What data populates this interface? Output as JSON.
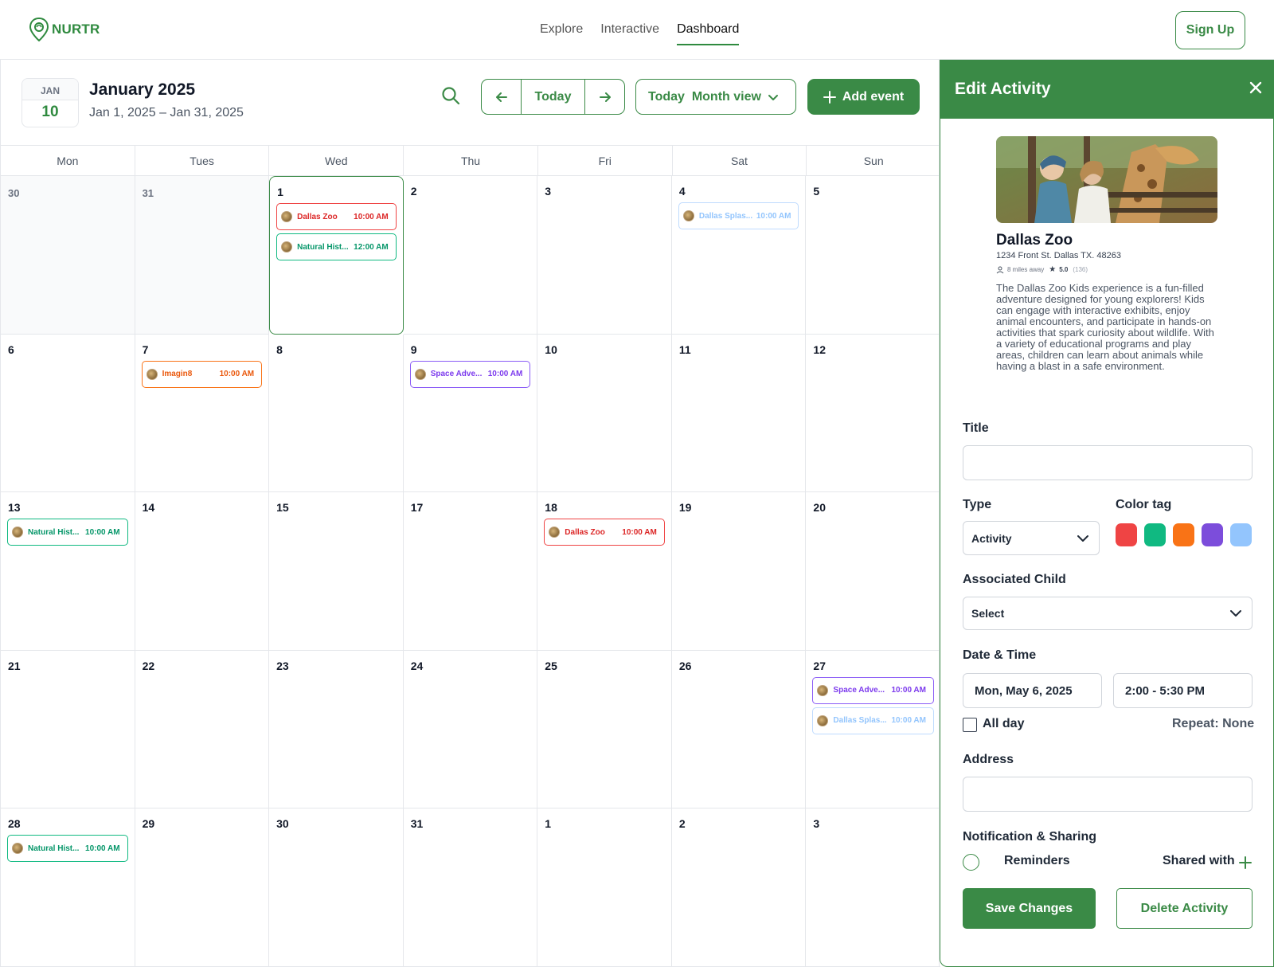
{
  "nav": {
    "brand": "NURTR",
    "links": [
      "Explore",
      "Interactive",
      "Dashboard"
    ],
    "active": "Dashboard",
    "signup_label": "Sign Up"
  },
  "calendar": {
    "date_badge": {
      "month": "JAN",
      "day": "10"
    },
    "title": "January 2025",
    "range": "Jan 1, 2025 – Jan 31, 2025",
    "today_label": "Today",
    "view_label": "Today  Month view",
    "add_event_label": "Add event",
    "weekdays": [
      "Mon",
      "Tues",
      "Wed",
      "Thu",
      "Fri",
      "Sat",
      "Sun"
    ],
    "cells": [
      {
        "day": "30",
        "muted": true,
        "events": []
      },
      {
        "day": "31",
        "muted": true,
        "events": []
      },
      {
        "day": "1",
        "selected": true,
        "events": [
          {
            "name": "Dallas Zoo",
            "time": "10:00 AM",
            "color": "red"
          },
          {
            "name": "Natural Hist...",
            "time": "12:00 AM",
            "color": "green"
          }
        ]
      },
      {
        "day": "2",
        "events": []
      },
      {
        "day": "3",
        "events": []
      },
      {
        "day": "4",
        "events": [
          {
            "name": "Dallas Splas...",
            "time": "10:00 AM",
            "color": "blue"
          }
        ]
      },
      {
        "day": "5",
        "events": []
      },
      {
        "day": "6",
        "events": []
      },
      {
        "day": "7",
        "events": [
          {
            "name": "Imagin8",
            "time": "10:00 AM",
            "color": "orange"
          }
        ]
      },
      {
        "day": "8",
        "events": []
      },
      {
        "day": "9",
        "events": [
          {
            "name": "Space Adve...",
            "time": "10:00 AM",
            "color": "purple"
          }
        ]
      },
      {
        "day": "10",
        "events": []
      },
      {
        "day": "11",
        "events": []
      },
      {
        "day": "12",
        "events": []
      },
      {
        "day": "13",
        "events": [
          {
            "name": "Natural Hist...",
            "time": "10:00 AM",
            "color": "green"
          }
        ]
      },
      {
        "day": "14",
        "events": []
      },
      {
        "day": "15",
        "events": []
      },
      {
        "day": "17",
        "events": []
      },
      {
        "day": "18",
        "events": [
          {
            "name": "Dallas Zoo",
            "time": "10:00 AM",
            "color": "red"
          }
        ]
      },
      {
        "day": "19",
        "events": []
      },
      {
        "day": "20",
        "events": []
      },
      {
        "day": "21",
        "events": []
      },
      {
        "day": "22",
        "events": []
      },
      {
        "day": "23",
        "events": []
      },
      {
        "day": "24",
        "events": []
      },
      {
        "day": "25",
        "events": []
      },
      {
        "day": "26",
        "events": []
      },
      {
        "day": "27",
        "events": [
          {
            "name": "Space Adve...",
            "time": "10:00 AM",
            "color": "purple"
          },
          {
            "name": "Dallas Splas...",
            "time": "10:00 AM",
            "color": "blue"
          }
        ]
      },
      {
        "day": "28",
        "events": [
          {
            "name": "Natural Hist...",
            "time": "10:00 AM",
            "color": "green"
          }
        ]
      },
      {
        "day": "29",
        "events": []
      },
      {
        "day": "30",
        "events": []
      },
      {
        "day": "31",
        "events": []
      },
      {
        "day": "1",
        "events": []
      },
      {
        "day": "2",
        "events": []
      },
      {
        "day": "3",
        "events": []
      }
    ]
  },
  "panel": {
    "title": "Edit Activity",
    "activity": {
      "name": "Dallas Zoo",
      "address": "1234 Front St. Dallas TX. 48263",
      "distance": "8 miles away",
      "rating": "5.0",
      "reviews": "(136)",
      "description": "The Dallas Zoo Kids experience is a fun-filled adventure designed for young explorers! Kids can engage with interactive exhibits, enjoy animal encounters, and participate in hands-on activities that spark curiosity about wildlife. With a variety of educational programs and play areas, children can learn about animals while having a blast in a safe environment."
    },
    "labels": {
      "title": "Title",
      "type": "Type",
      "color_tag": "Color tag",
      "associated_child": "Associated Child",
      "date_time": "Date & Time",
      "all_day": "All day",
      "repeat": "Repeat: None",
      "address": "Address",
      "notification": "Notification & Sharing",
      "reminders": "Reminders",
      "shared_with": "Shared with"
    },
    "type_value": "Activity",
    "child_value": "Select",
    "date_value": "Mon, May 6, 2025",
    "time_value": "2:00 - 5:30 PM",
    "color_tags": [
      "#ef4444",
      "#10b981",
      "#f97316",
      "#7c4ddb",
      "#93c5fd"
    ],
    "save_label": "Save Changes",
    "delete_label": "Delete Activity"
  }
}
